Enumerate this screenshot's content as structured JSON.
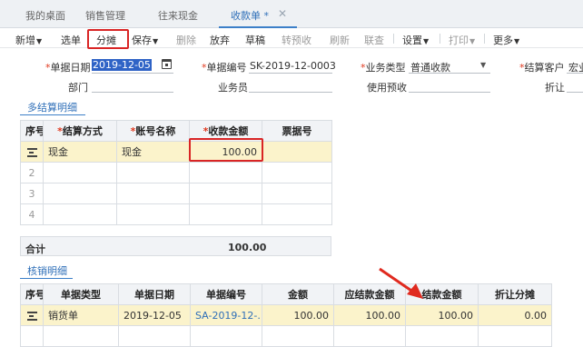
{
  "tabs": [
    {
      "label": "我的桌面"
    },
    {
      "label": "销售管理"
    },
    {
      "label": "往来现金"
    },
    {
      "label": "收款单 *"
    }
  ],
  "tab_close": "✕",
  "toolbar": {
    "add": "新增",
    "select": "选单",
    "split": "分摊",
    "save": "保存",
    "delete": "删除",
    "abandon": "放弃",
    "draft": "草稿",
    "to_prepay": "转预收",
    "refresh": "刷新",
    "query": "联查",
    "settings": "设置",
    "print": "打印",
    "more": "更多"
  },
  "form": {
    "date_label": "单据日期",
    "date_value": "2019-12-05",
    "doc_no_label": "单据编号",
    "doc_no_value": "SK-2019-12-0003",
    "biz_type_label": "业务类型",
    "biz_type_value": "普通收款",
    "customer_label": "结算客户",
    "customer_value": "宏业",
    "dept_label": "部门",
    "salesman_label": "业务员",
    "use_prepay_label": "使用预收",
    "discount_label": "折让"
  },
  "settlement": {
    "title": "多结算明细",
    "headers": {
      "seq": "序号",
      "method": "结算方式",
      "account": "账号名称",
      "amount": "收款金额",
      "ticket": "票据号"
    },
    "rows": [
      {
        "seq": "",
        "method": "现金",
        "account": "现金",
        "amount": "100.00",
        "ticket": ""
      },
      {
        "seq": "2"
      },
      {
        "seq": "3"
      },
      {
        "seq": "4"
      }
    ],
    "total_label": "合计",
    "total_value": "100.00"
  },
  "writeoff": {
    "title": "核销明细",
    "headers": {
      "seq": "序号",
      "doc_type": "单据类型",
      "doc_date": "单据日期",
      "doc_no": "单据编号",
      "amount": "金额",
      "due": "应结款金额",
      "settled": "结款金额",
      "discount": "折让分摊"
    },
    "rows": [
      {
        "doc_type": "销货单",
        "doc_date": "2019-12-05",
        "doc_no": "SA-2019-12-...",
        "amount": "100.00",
        "due": "100.00",
        "settled": "100.00",
        "discount": "0.00"
      }
    ]
  }
}
